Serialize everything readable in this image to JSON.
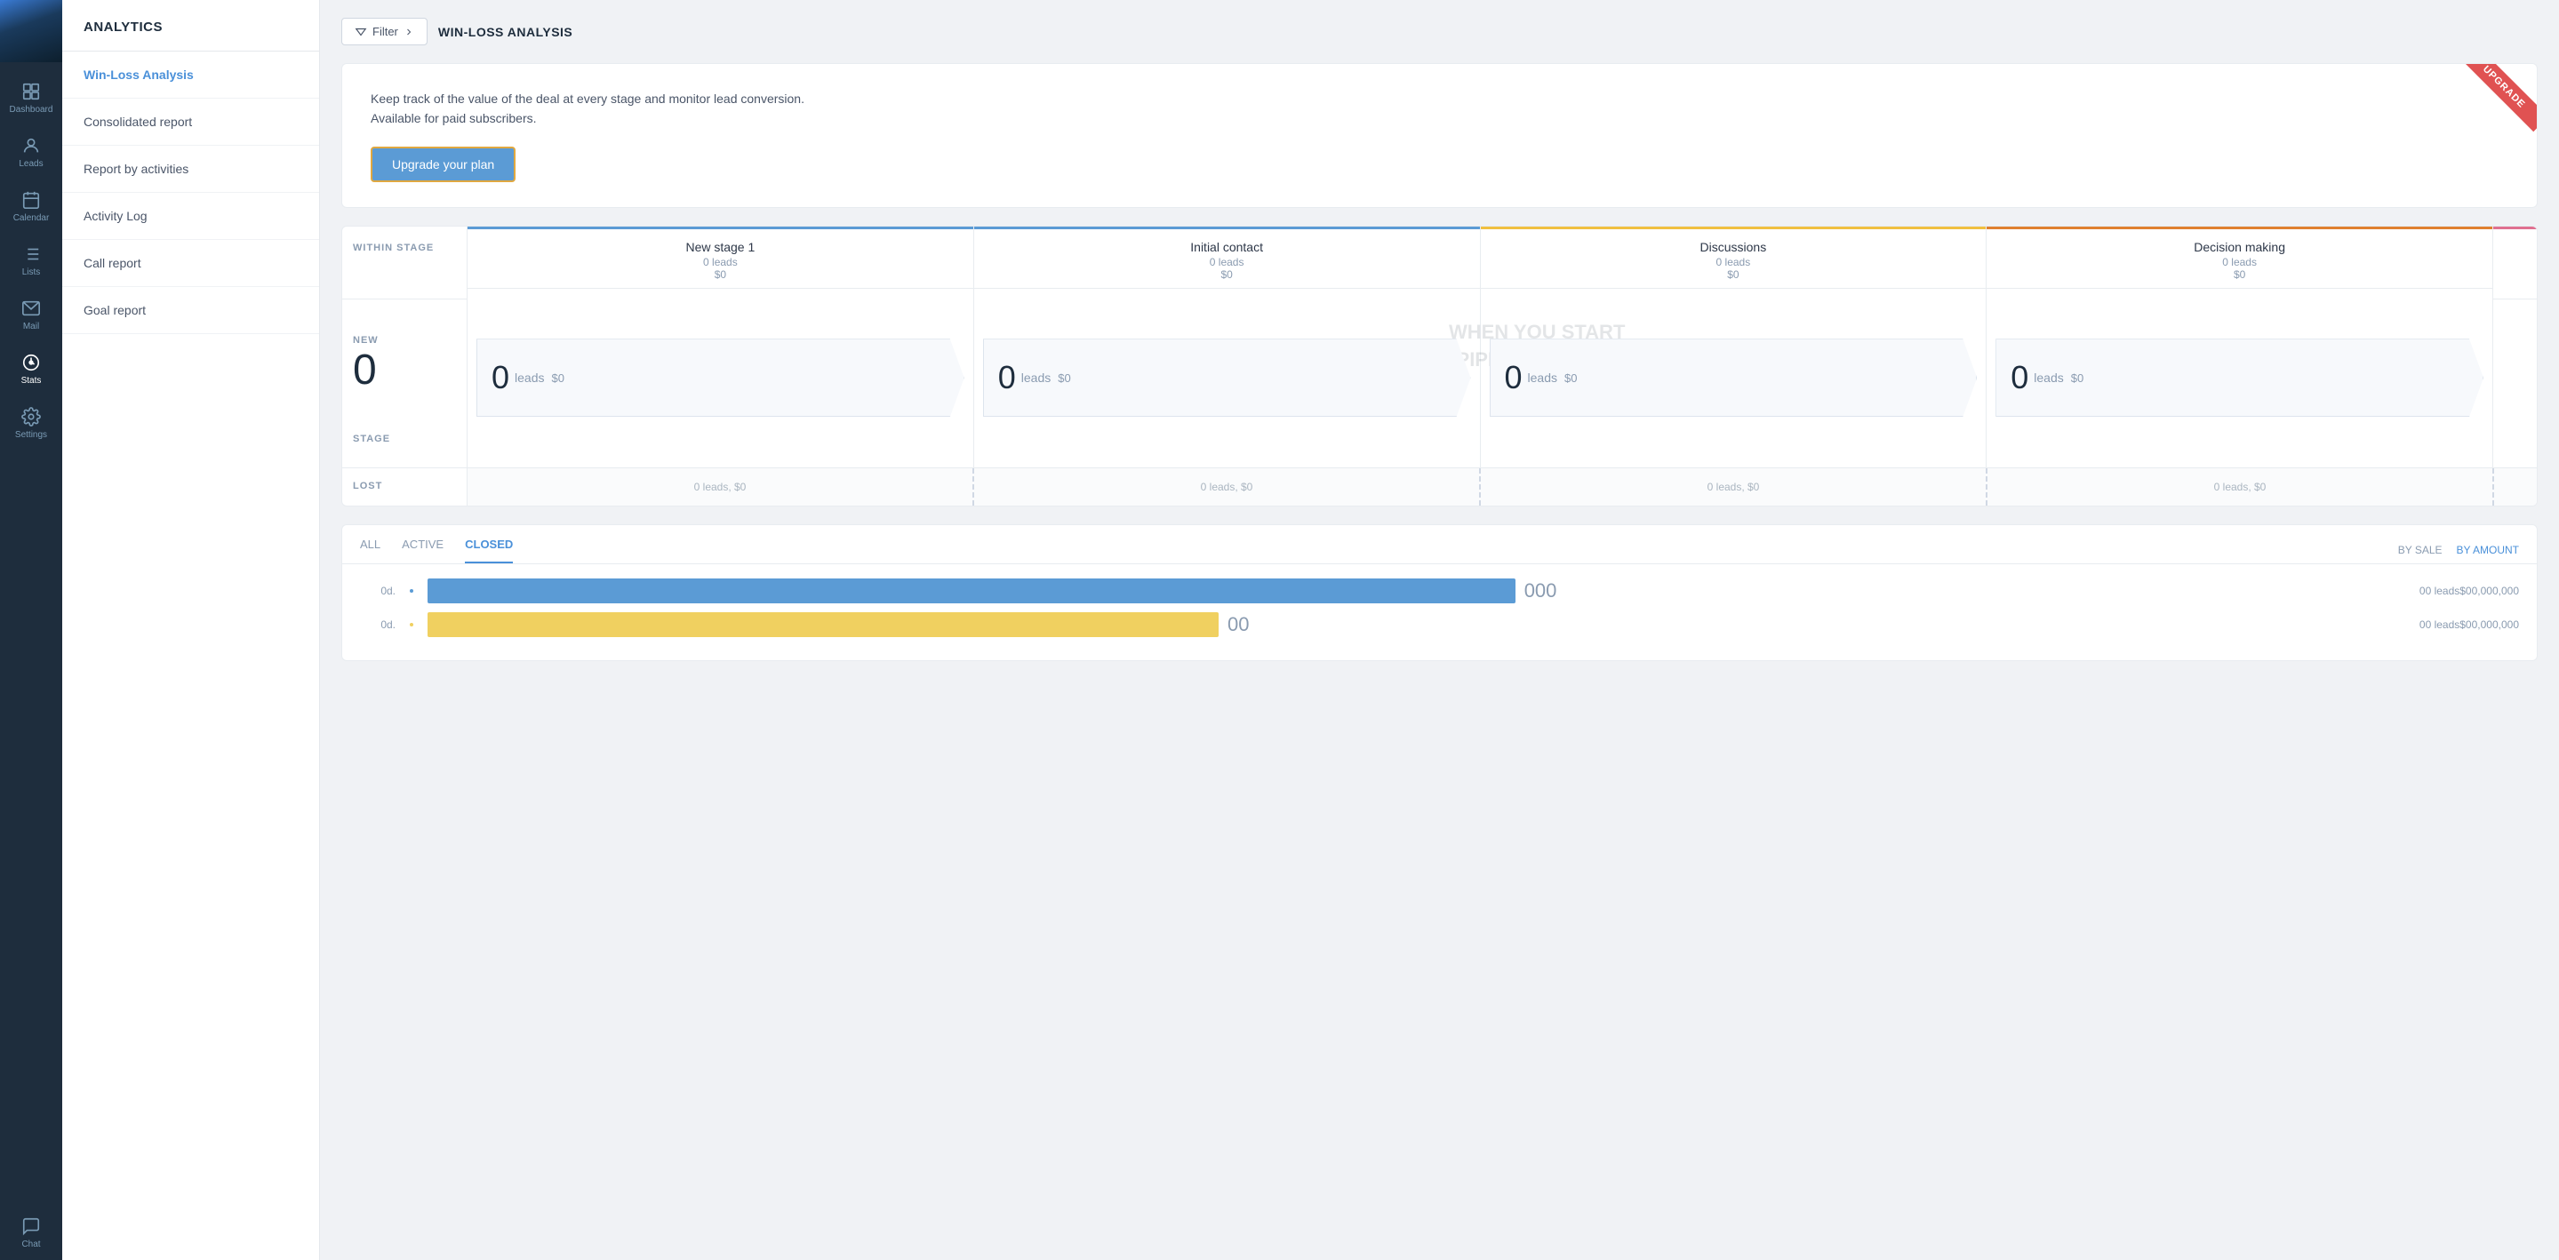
{
  "iconNav": {
    "items": [
      {
        "name": "dashboard",
        "label": "Dashboard",
        "icon": "dashboard"
      },
      {
        "name": "leads",
        "label": "Leads",
        "icon": "leads"
      },
      {
        "name": "calendar",
        "label": "Calendar",
        "icon": "calendar"
      },
      {
        "name": "lists",
        "label": "Lists",
        "icon": "lists"
      },
      {
        "name": "mail",
        "label": "Mail",
        "icon": "mail"
      },
      {
        "name": "stats",
        "label": "Stats",
        "icon": "stats",
        "active": true
      },
      {
        "name": "settings",
        "label": "Settings",
        "icon": "settings"
      },
      {
        "name": "chat",
        "label": "Chat",
        "icon": "chat"
      }
    ]
  },
  "sidebar": {
    "title": "ANALYTICS",
    "items": [
      {
        "label": "Win-Loss Analysis",
        "active": true
      },
      {
        "label": "Consolidated report"
      },
      {
        "label": "Report by activities"
      },
      {
        "label": "Activity Log"
      },
      {
        "label": "Call report"
      },
      {
        "label": "Goal report"
      }
    ]
  },
  "header": {
    "filter_label": "Filter",
    "page_title": "WIN-LOSS ANALYSIS"
  },
  "upgrade_card": {
    "text_line1": "Keep track of the value of the deal at every stage and monitor lead conversion.",
    "text_line2": "Available for paid subscribers.",
    "btn_label": "Upgrade your plan",
    "ribbon_label": "UPGRADE"
  },
  "pipeline": {
    "row_labels": {
      "within_stage": "WITHIN STAGE",
      "stage": "STAGE",
      "new_label": "NEW",
      "new_count": "0",
      "lost": "LOST"
    },
    "watermark": "WHEN YOU START\nPIPELINE STATIS",
    "stages": [
      {
        "name": "New stage 1",
        "leads_top": "0 leads",
        "amount_top": "$0",
        "leads_big": "0",
        "leads_label": "leads",
        "amount_bottom": "$0",
        "color": "blue",
        "lost": "0 leads, $0"
      },
      {
        "name": "Initial contact",
        "leads_top": "0 leads",
        "amount_top": "$0",
        "leads_big": "0",
        "leads_label": "leads",
        "amount_bottom": "$0",
        "color": "blue",
        "lost": "0 leads, $0"
      },
      {
        "name": "Discussions",
        "leads_top": "0 leads",
        "amount_top": "$0",
        "leads_big": "0",
        "leads_label": "leads",
        "amount_bottom": "$0",
        "color": "yellow",
        "lost": "0 leads, $0"
      },
      {
        "name": "Decision making",
        "leads_top": "0 leads",
        "amount_top": "$0",
        "leads_big": "0",
        "leads_label": "leads",
        "amount_bottom": "$0",
        "color": "orange",
        "lost": "0 leads, $0"
      }
    ]
  },
  "bottom": {
    "tabs": [
      {
        "label": "ALL"
      },
      {
        "label": "ACTIVE"
      },
      {
        "label": "CLOSED",
        "active": true
      }
    ],
    "sort_options": [
      {
        "label": "BY SALE"
      },
      {
        "label": "BY AMOUNT",
        "active": true
      }
    ],
    "chart_rows": [
      {
        "label": "0d.",
        "count": "000",
        "bar_width": "55%",
        "bar_color": "blue",
        "meta": "00 leads$00,000,000"
      },
      {
        "label": "0d.",
        "count": "00",
        "bar_width": "40%",
        "bar_color": "yellow",
        "meta": "00 leads$00,000,000"
      }
    ]
  }
}
